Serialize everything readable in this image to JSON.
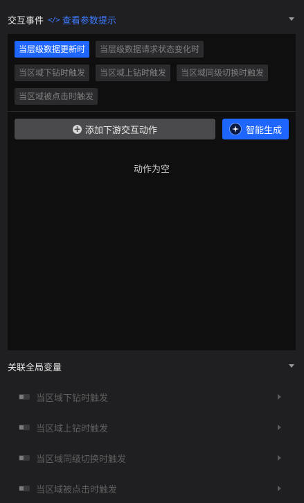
{
  "interaction": {
    "title": "交互事件",
    "hint_icon": "code-icon",
    "hint_label": "查看参数提示",
    "tags": [
      {
        "label": "当层级数据更新时",
        "active": true
      },
      {
        "label": "当层级数据请求状态变化时",
        "active": false
      },
      {
        "label": "当区域下钻时触发",
        "active": false
      },
      {
        "label": "当区域上钻时触发",
        "active": false
      },
      {
        "label": "当区域同级切换时触发",
        "active": false
      },
      {
        "label": "当区域被点击时触发",
        "active": false
      }
    ],
    "add_button_label": "添加下游交互动作",
    "ai_button_label": "智能生成",
    "empty_text": "动作为空"
  },
  "global_vars": {
    "title": "关联全局变量",
    "items": [
      {
        "label": "当区域下钻时触发"
      },
      {
        "label": "当区域上钻时触发"
      },
      {
        "label": "当区域同级切换时触发"
      },
      {
        "label": "当区域被点击时触发"
      }
    ]
  },
  "colors": {
    "accent": "#1f66ff",
    "background": "#1f1f22",
    "panel": "#0f0f10"
  }
}
